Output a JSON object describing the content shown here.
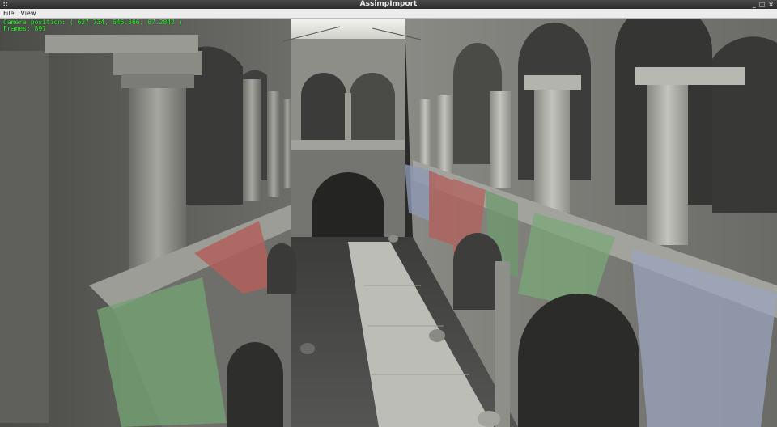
{
  "window": {
    "title": "AssimpImport",
    "grip_glyph": "∷",
    "min_glyph": "_",
    "max_glyph": "□",
    "close_glyph": "×"
  },
  "menu": {
    "items": [
      {
        "label": "File"
      },
      {
        "label": "View"
      }
    ]
  },
  "hud": {
    "camera_label": "Camera position:",
    "camera_value": "( 627.734, 646.566, 67.2842 )",
    "frames_label": "Frames:",
    "frames_value": "897"
  },
  "scene": {
    "description_icon": "sponza-atrium-render",
    "colors": {
      "hud_text": "#2bff2b",
      "stone": "#9a9a94",
      "drape_red": "#a35a55",
      "drape_green": "#6e9a6c",
      "drape_blue": "#8d98b3"
    }
  }
}
